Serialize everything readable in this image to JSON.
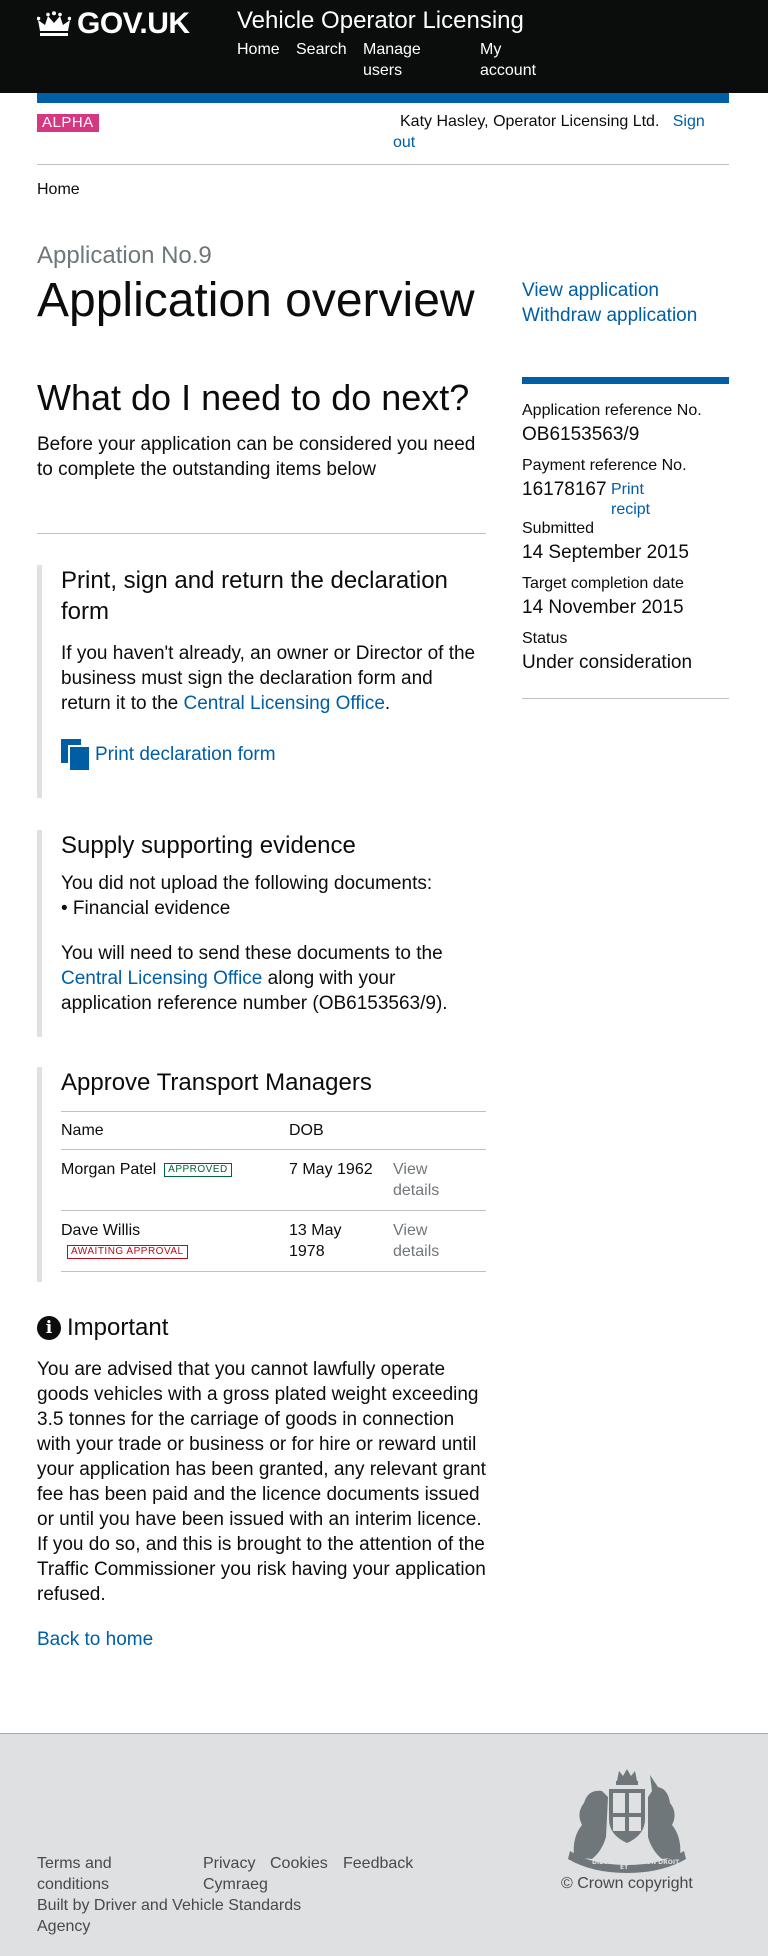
{
  "header": {
    "logo_text": "GOV.UK",
    "service_name": "Vehicle Operator Licensing",
    "nav": [
      "Home",
      "Search",
      "Manage users",
      "My account"
    ]
  },
  "phase": {
    "tag": "ALPHA",
    "user": "Katy Hasley, Operator Licensing Ltd.",
    "sign_out": "Sign out"
  },
  "breadcrumb": {
    "home": "Home"
  },
  "page": {
    "application_no": "Application No.9",
    "title": "Application overview",
    "view_application": "View application",
    "withdraw_application": "Withdraw application"
  },
  "next": {
    "heading": "What do I need to do next?",
    "intro": "Before your application can be considered you need to complete the outstanding items below"
  },
  "summary": {
    "ref_label": "Application reference No.",
    "ref_value": "OB6153563/9",
    "payment_label": "Payment reference No.",
    "payment_value": "16178167",
    "print_receipt": "Print recipt",
    "submitted_label": "Submitted",
    "submitted_value": "14 September 2015",
    "target_label": "Target completion date",
    "target_value": "14 November 2015",
    "status_label": "Status",
    "status_value": "Under consideration"
  },
  "declaration": {
    "heading": "Print, sign and return the declaration form",
    "text_before": "If you haven't already, an owner or Director of the business must sign the declaration form and return it to the ",
    "office_link": "Central Licensing Office",
    "text_after": ".",
    "print_link": "Print declaration form"
  },
  "evidence": {
    "heading": "Supply supporting evidence",
    "missing_intro": "You did not upload the following documents:",
    "missing_item": "• Financial evidence",
    "send_before": "You will need to send these documents to the ",
    "office_link": "Central Licensing Office",
    "send_after": " along with your application reference number (OB6153563/9)."
  },
  "managers": {
    "heading": "Approve Transport Managers",
    "col_name": "Name",
    "col_dob": "DOB",
    "rows": [
      {
        "name": "Morgan Patel",
        "status": "APPROVED",
        "dob": "7 May 1962",
        "link": "View details"
      },
      {
        "name": "Dave Willis",
        "status": "AWAITING APPROVAL",
        "dob": "13 May 1978",
        "link": "View details"
      }
    ]
  },
  "important": {
    "heading": "Important",
    "text": "You are advised that you cannot lawfully operate goods vehicles with a gross plated weight exceeding 3.5 tonnes for the carriage of goods in connection with your trade or business or for hire or reward until your application has been granted, any relevant grant fee has been paid and the licence documents issued or until you have been issued with an interim licence. If you do so, and this is brought to the attention of the Traffic Commissioner you risk having your application refused.",
    "back_link": "Back to home"
  },
  "footer": {
    "terms": "Terms and conditions",
    "privacy": "Privacy",
    "cookies": "Cookies",
    "feedback": "Feedback",
    "cymraeg": "Cymraeg",
    "built_by": "Built by ",
    "agency": "Driver and Vehicle Standards Agency",
    "copyright": "© Crown copyright",
    "crest_motto_left": "DIEU",
    "crest_motto_right": "MON DROIT",
    "crest_motto_bottom": "ET"
  },
  "colors": {
    "header_bg": "#0b0c0c",
    "brand_blue": "#005ea5",
    "alpha_pink": "#d53880",
    "approved_green": "#006435",
    "awaiting_red": "#b10e1e",
    "footer_bg": "#dee0e2"
  },
  "icons": [
    "crown-icon",
    "document-icon",
    "info-icon",
    "royal-crest"
  ]
}
